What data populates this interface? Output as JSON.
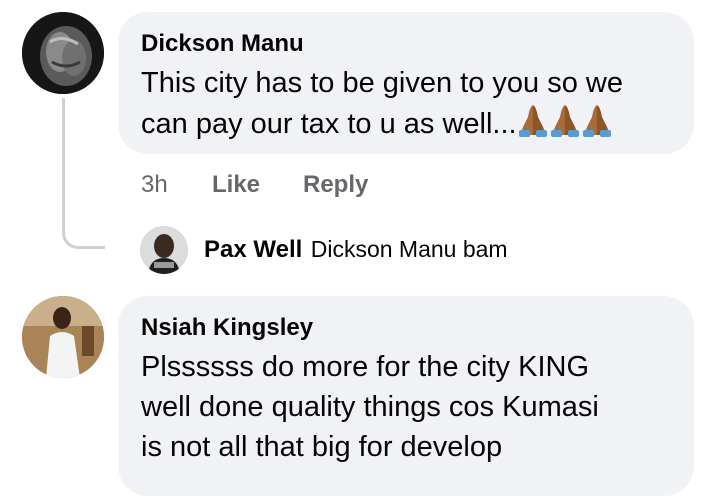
{
  "comments": [
    {
      "author": "Dickson Manu",
      "line1": "This city has to be given to you so we",
      "line2": "can pay our tax to u as well...",
      "emoji": [
        "folded-hands-icon",
        "folded-hands-icon",
        "folded-hands-icon"
      ],
      "time": "3h",
      "like": "Like",
      "reply": "Reply"
    },
    {
      "author": "Nsiah Kingsley",
      "lines": [
        "Plssssss do more for the city KING",
        "well done quality things cos Kumasi",
        "is not all that big for develop"
      ]
    }
  ],
  "reply": {
    "author": "Pax Well",
    "text": "Dickson Manu bam"
  },
  "colors": {
    "bubble": "#f0f2f5",
    "secondary_text": "#65676b",
    "thread_line": "#ced0d4"
  }
}
